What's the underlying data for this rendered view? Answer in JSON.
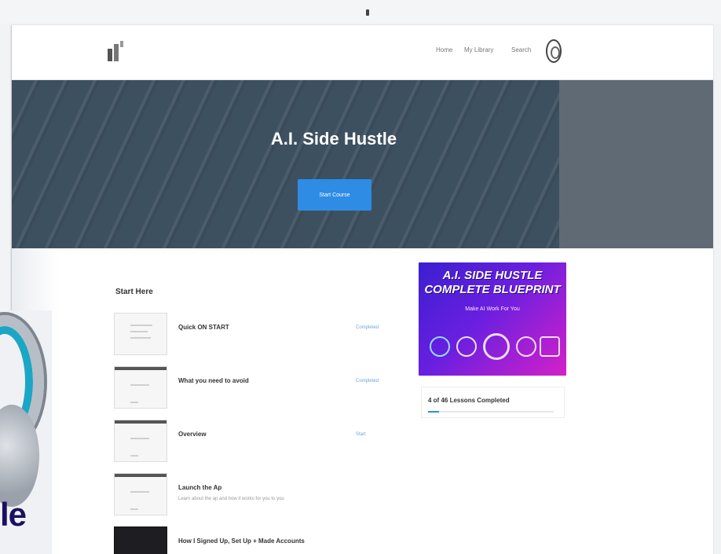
{
  "nav": {
    "links": [
      {
        "label": "Home"
      },
      {
        "label": "My Library"
      },
      {
        "label": "Search"
      }
    ]
  },
  "hero": {
    "title": "A.I. Side Hustle",
    "button_label": "Start Course"
  },
  "section_title": "Start Here",
  "lessons": [
    {
      "title": "Quick ON START",
      "subtitle": "",
      "status": "Completed"
    },
    {
      "title": "What you need to avoid",
      "subtitle": "",
      "status": "Completed"
    },
    {
      "title": "Overview",
      "subtitle": "",
      "status": "Start"
    },
    {
      "title": "Launch the Ap",
      "subtitle": "Learn about the ap and how it works for you to you",
      "status": ""
    },
    {
      "title": "How I Signed Up, Set Up + Made Accounts",
      "subtitle": "",
      "status": ""
    }
  ],
  "course_card": {
    "title_line1": "A.I. SIDE HUSTLE",
    "title_line2": "COMPLETE BLUEPRINT",
    "subtitle": "Make AI Work For You",
    "progress_text": "4 of 46 Lessons Completed",
    "progress_fraction": 0.09
  },
  "promo": {
    "text": "le"
  },
  "colors": {
    "accent": "#2f8ce5",
    "hero_bg": "#3d5060",
    "card_gradient_start": "#3b1fd0",
    "card_gradient_end": "#d421c8"
  }
}
